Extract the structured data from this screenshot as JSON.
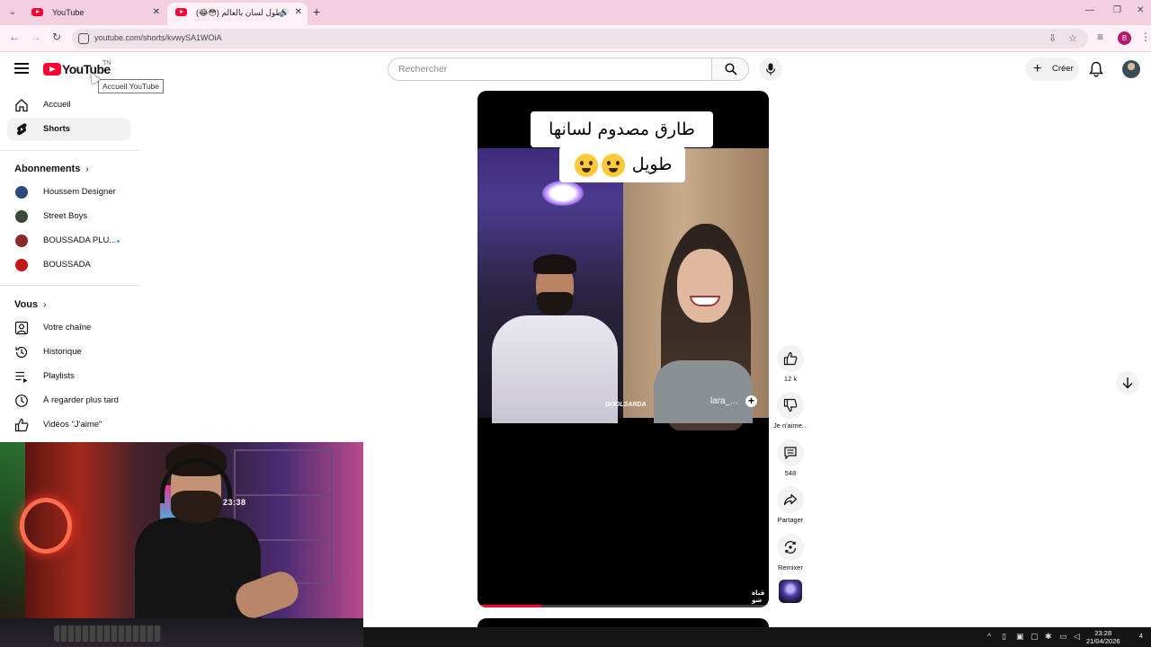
{
  "browser": {
    "tabs": [
      {
        "title": "YouTube",
        "active": false
      },
      {
        "title": "(😂😳) اطول لسان بالعالم #shorts",
        "active": true
      }
    ],
    "url": "youtube.com/shorts/kvwySA1WOiA",
    "profile_initial": "B"
  },
  "header": {
    "logo_text": "YouTube",
    "logo_country": "TN",
    "logo_tooltip": "Accueil YouTube",
    "search_placeholder": "Rechercher",
    "create_label": "Créer"
  },
  "sidebar": {
    "main": [
      {
        "label": "Accueil",
        "icon": "home-icon",
        "active": false
      },
      {
        "label": "Shorts",
        "icon": "shorts-icon",
        "active": true
      }
    ],
    "subscriptions_title": "Abonnements",
    "subscriptions": [
      {
        "label": "Houssem Designer",
        "color": "#2f4a7a"
      },
      {
        "label": "Street Boys",
        "color": "#3a4a3a"
      },
      {
        "label": "BOUSSADA PLU...",
        "color": "#8a2a2a",
        "live": true
      },
      {
        "label": "BOUSSADA",
        "color": "#c21818"
      }
    ],
    "you_title": "Vous",
    "you_items": [
      {
        "label": "Votre chaîne",
        "icon": "channel-icon"
      },
      {
        "label": "Historique",
        "icon": "history-icon"
      },
      {
        "label": "Playlists",
        "icon": "playlists-icon"
      },
      {
        "label": "À regarder plus tard",
        "icon": "watch-later-icon"
      },
      {
        "label": "Vidéos \"J'aime\"",
        "icon": "liked-videos-icon"
      }
    ]
  },
  "short": {
    "caption_line1": "طارق مصدوم لسانها",
    "caption_line2": "طويل",
    "watermark_left": "GOOLSARDA",
    "watermark_right": "lara_...",
    "channel_tag": "قناة شو",
    "progress": 0.22
  },
  "actions": {
    "like_count": "12 k",
    "dislike_label": "Je n'aime...",
    "comments_count": "548",
    "share_label": "Partager",
    "remix_label": "Remixer"
  },
  "webcam": {
    "clock_text": "23:38"
  },
  "taskbar": {
    "time": "23:28",
    "date": "21/04/2026",
    "notifications": "4"
  },
  "colors": {
    "brand_red": "#ff0033",
    "tab_strip": "#f2cfe1",
    "accent_blue": "#3ea6ff"
  }
}
